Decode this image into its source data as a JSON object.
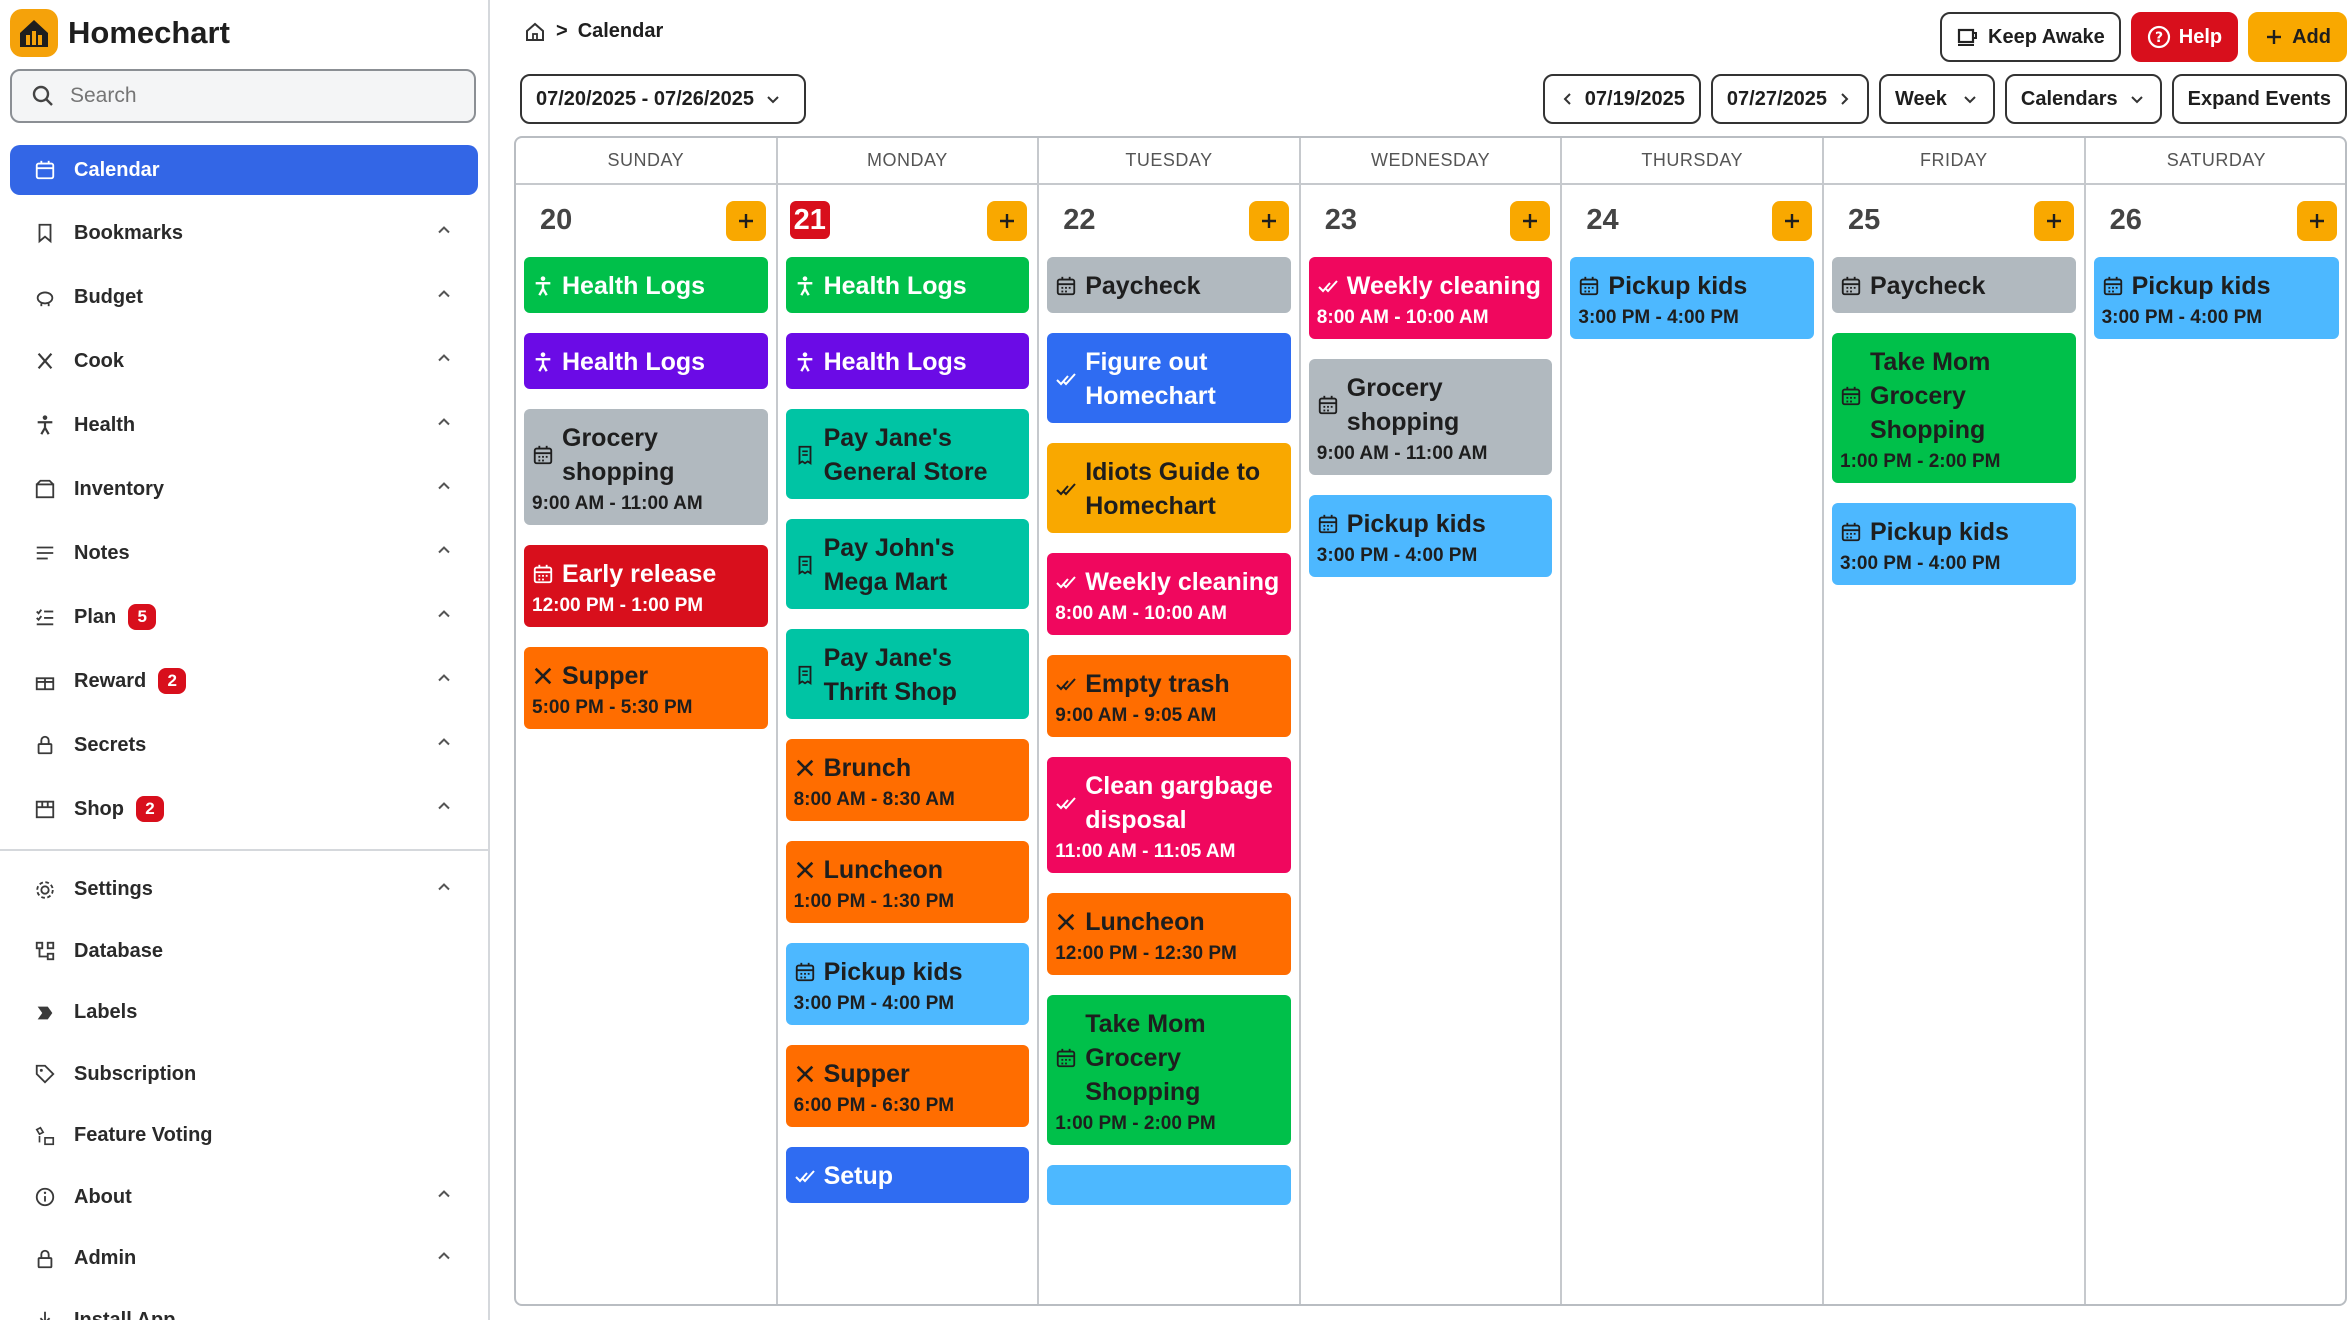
{
  "app": {
    "name": "Homechart"
  },
  "colors": {
    "primary": "#3366e6",
    "accent": "#f9a800",
    "danger": "#d80f1c"
  },
  "search": {
    "placeholder": "Search"
  },
  "sidebar": {
    "items": [
      {
        "label": "Calendar",
        "icon": "calendar-icon",
        "active": true
      },
      {
        "label": "Bookmarks",
        "icon": "bookmark-icon"
      },
      {
        "label": "Budget",
        "icon": "piggy-bank-icon"
      },
      {
        "label": "Cook",
        "icon": "utensils-icon"
      },
      {
        "label": "Health",
        "icon": "person-icon"
      },
      {
        "label": "Inventory",
        "icon": "box-icon"
      },
      {
        "label": "Notes",
        "icon": "notes-icon"
      },
      {
        "label": "Plan",
        "icon": "checklist-icon",
        "badge": "5"
      },
      {
        "label": "Reward",
        "icon": "gift-icon",
        "badge": "2"
      },
      {
        "label": "Secrets",
        "icon": "lock-icon"
      },
      {
        "label": "Shop",
        "icon": "store-icon",
        "badge": "2"
      }
    ],
    "secondary": [
      {
        "label": "Settings",
        "icon": "gear-icon"
      },
      {
        "label": "Database",
        "icon": "database-icon"
      },
      {
        "label": "Labels",
        "icon": "label-icon"
      },
      {
        "label": "Subscription",
        "icon": "tag-icon"
      },
      {
        "label": "Feature Voting",
        "icon": "vote-icon"
      },
      {
        "label": "About",
        "icon": "info-icon"
      },
      {
        "label": "Admin",
        "icon": "admin-icon"
      },
      {
        "label": "Install App",
        "icon": "download-icon"
      }
    ]
  },
  "breadcrumb": {
    "separator": ">",
    "current": "Calendar"
  },
  "header": {
    "keep_awake": "Keep Awake",
    "help": "Help",
    "add": "Add"
  },
  "toolbar": {
    "range": "07/20/2025 - 07/26/2025",
    "prev": "07/19/2025",
    "next": "07/27/2025",
    "view": "Week",
    "calendars": "Calendars",
    "expand": "Expand Events"
  },
  "days": [
    {
      "dow": "SUNDAY",
      "num": "20",
      "events": [
        {
          "title": "Health Logs",
          "color": "green",
          "icon": "person"
        },
        {
          "title": "Health Logs",
          "color": "purple",
          "icon": "person"
        },
        {
          "title": "Grocery shopping",
          "time": "9:00 AM - 11:00 AM",
          "color": "gray",
          "icon": "calendar"
        },
        {
          "title": "Early release",
          "time": "12:00 PM - 1:00 PM",
          "color": "red",
          "icon": "calendar"
        },
        {
          "title": "Supper",
          "time": "5:00 PM - 5:30 PM",
          "color": "orange",
          "icon": "utensils"
        }
      ]
    },
    {
      "dow": "MONDAY",
      "num": "21",
      "today": true,
      "events": [
        {
          "title": "Health Logs",
          "color": "green",
          "icon": "person"
        },
        {
          "title": "Health Logs",
          "color": "purple",
          "icon": "person"
        },
        {
          "title": "Pay Jane's General Store",
          "color": "teal",
          "icon": "receipt"
        },
        {
          "title": "Pay John's Mega Mart",
          "color": "teal",
          "icon": "receipt"
        },
        {
          "title": "Pay Jane's Thrift Shop",
          "color": "teal",
          "icon": "receipt"
        },
        {
          "title": "Brunch",
          "time": "8:00 AM - 8:30 AM",
          "color": "orange",
          "icon": "utensils"
        },
        {
          "title": "Luncheon",
          "time": "1:00 PM - 1:30 PM",
          "color": "orange",
          "icon": "utensils"
        },
        {
          "title": "Pickup kids",
          "time": "3:00 PM - 4:00 PM",
          "color": "sky",
          "icon": "calendar"
        },
        {
          "title": "Supper",
          "time": "6:00 PM - 6:30 PM",
          "color": "orange",
          "icon": "utensils"
        },
        {
          "title": "Setup",
          "color": "blue",
          "icon": "check"
        }
      ]
    },
    {
      "dow": "TUESDAY",
      "num": "22",
      "events": [
        {
          "title": "Paycheck",
          "color": "gray",
          "icon": "calendar"
        },
        {
          "title": "Figure out Homechart",
          "color": "blue",
          "icon": "check"
        },
        {
          "title": "Idiots Guide to Homechart",
          "color": "yellow",
          "icon": "check"
        },
        {
          "title": "Weekly cleaning",
          "time": "8:00 AM - 10:00 AM",
          "color": "pink",
          "icon": "check"
        },
        {
          "title": "Empty trash",
          "time": "9:00 AM - 9:05 AM",
          "color": "orange",
          "icon": "check"
        },
        {
          "title": "Clean gargbage disposal",
          "time": "11:00 AM - 11:05 AM",
          "color": "pink",
          "icon": "check"
        },
        {
          "title": "Luncheon",
          "time": "12:00 PM - 12:30 PM",
          "color": "orange",
          "icon": "utensils"
        },
        {
          "title": "Take Mom Grocery Shopping",
          "time": "1:00 PM - 2:00 PM",
          "color": "green",
          "icon": "calendar"
        },
        {
          "title": "",
          "color": "sky",
          "icon": ""
        }
      ]
    },
    {
      "dow": "WEDNESDAY",
      "num": "23",
      "events": [
        {
          "title": "Weekly cleaning",
          "time": "8:00 AM - 10:00 AM",
          "color": "pink",
          "icon": "check"
        },
        {
          "title": "Grocery shopping",
          "time": "9:00 AM - 11:00 AM",
          "color": "gray",
          "icon": "calendar"
        },
        {
          "title": "Pickup kids",
          "time": "3:00 PM - 4:00 PM",
          "color": "sky",
          "icon": "calendar"
        }
      ]
    },
    {
      "dow": "THURSDAY",
      "num": "24",
      "events": [
        {
          "title": "Pickup kids",
          "time": "3:00 PM - 4:00 PM",
          "color": "sky",
          "icon": "calendar"
        }
      ]
    },
    {
      "dow": "FRIDAY",
      "num": "25",
      "events": [
        {
          "title": "Paycheck",
          "color": "gray",
          "icon": "calendar"
        },
        {
          "title": "Take Mom Grocery Shopping",
          "time": "1:00 PM - 2:00 PM",
          "color": "green",
          "icon": "calendar"
        },
        {
          "title": "Pickup kids",
          "time": "3:00 PM - 4:00 PM",
          "color": "sky",
          "icon": "calendar"
        }
      ]
    },
    {
      "dow": "SATURDAY",
      "num": "26",
      "events": [
        {
          "title": "Pickup kids",
          "time": "3:00 PM - 4:00 PM",
          "color": "sky",
          "icon": "calendar"
        }
      ]
    }
  ]
}
